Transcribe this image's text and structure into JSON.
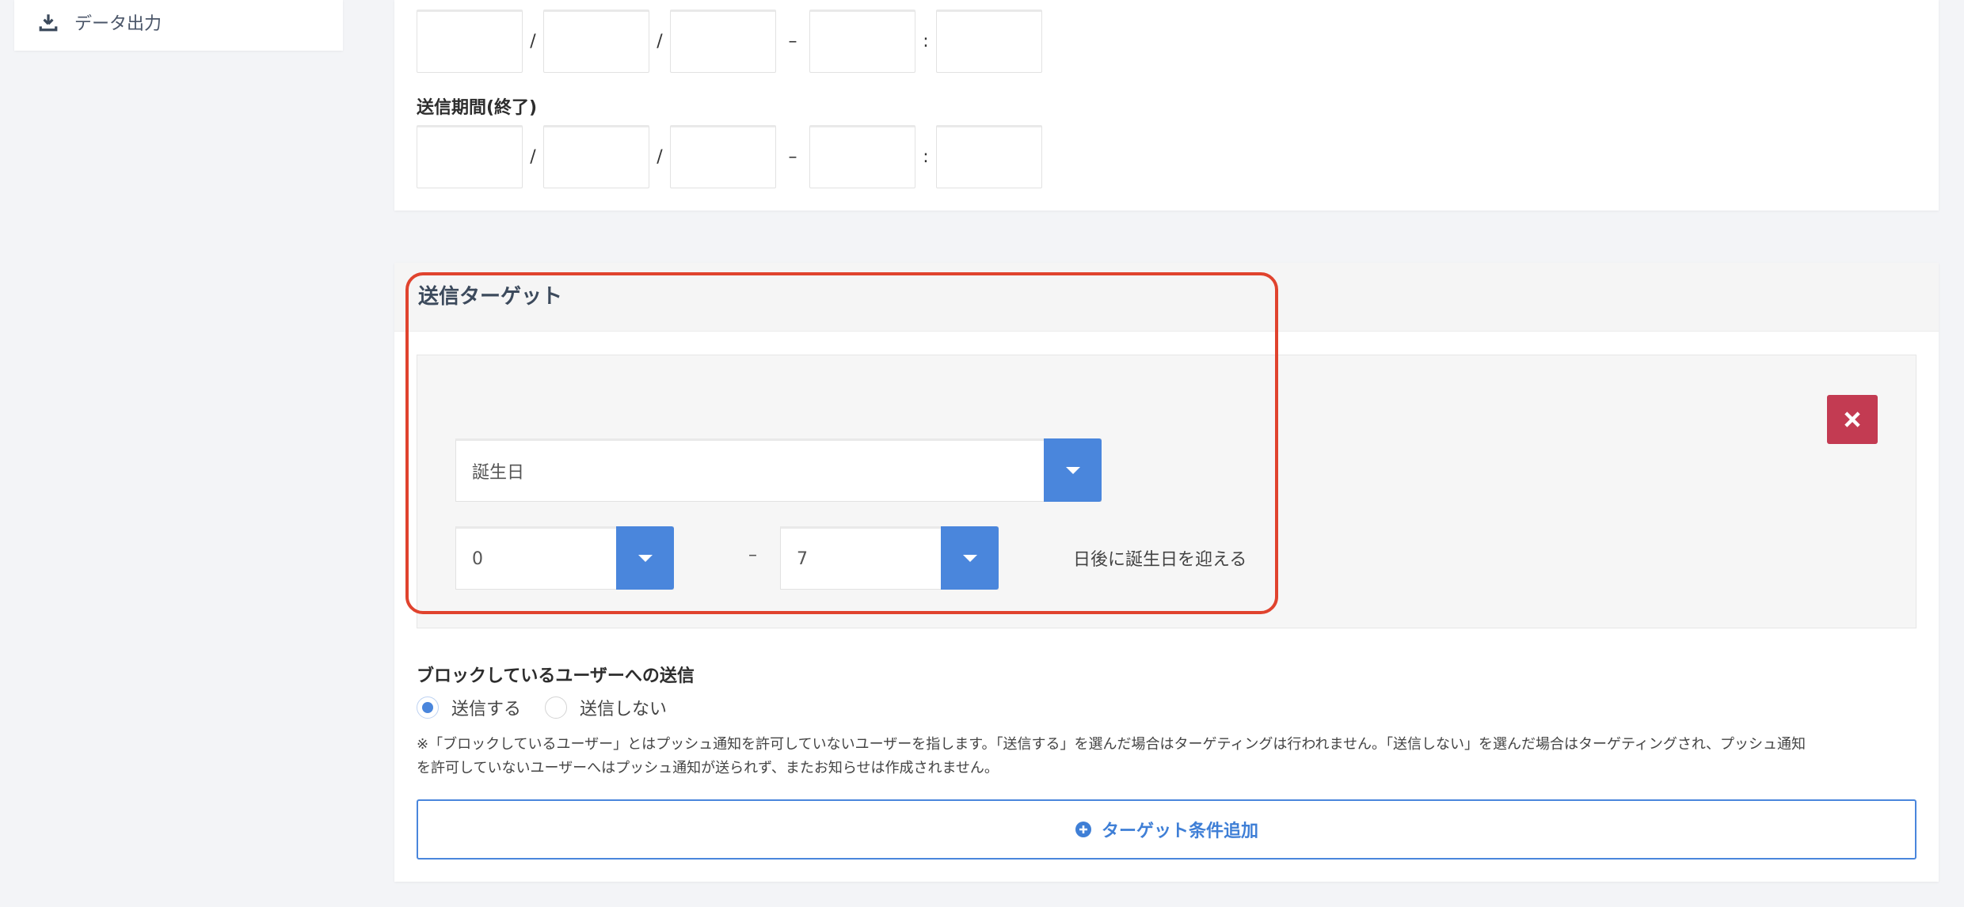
{
  "sidebar": {
    "item": {
      "label": "データ出力",
      "icon": "download-icon"
    }
  },
  "schedule": {
    "start_row": {
      "sep1": "/",
      "sep2": "/",
      "dash": "–",
      "colon": ":"
    },
    "end_label": "送信期間(終了)",
    "end_row": {
      "sep1": "/",
      "sep2": "/",
      "dash": "–",
      "colon": ":"
    }
  },
  "target": {
    "title": "送信ターゲット",
    "condition_type": "誕生日",
    "range_from": "0",
    "range_dash": "–",
    "range_to": "7",
    "range_suffix": "日後に誕生日を迎える",
    "delete_icon": "close-icon"
  },
  "block": {
    "label": "ブロックしているユーザーへの送信",
    "options": [
      "送信する",
      "送信しない"
    ],
    "selected": "送信する",
    "note_line1": "※「ブロックしているユーザー」とはプッシュ通知を許可していないユーザーを指します。「送信する」を選んだ場合はターゲティングは行われません。「送信しない」を選んだ場合はターゲティングされ、プッシュ通知",
    "note_line2": "を許可していないユーザーへはプッシュ通知が送られず、またお知らせは作成されません。"
  },
  "add_button": {
    "label": "ターゲット条件追加",
    "icon": "plus-circle-icon"
  },
  "colors": {
    "accent": "#4a86dc",
    "danger": "#c33b52",
    "highlight": "#e0432e"
  }
}
